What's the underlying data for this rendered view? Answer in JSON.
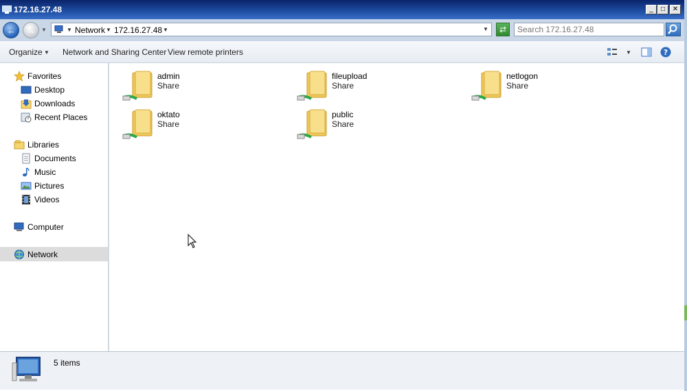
{
  "window": {
    "title": "172.16.27.48",
    "controls": {
      "minimize": "_",
      "maximize": "□",
      "close": "✕"
    }
  },
  "address": {
    "breadcrumbs": [
      "Network",
      "172.16.27.48"
    ],
    "search_placeholder": "Search 172.16.27.48"
  },
  "toolbar": {
    "organize": "Organize",
    "network_sharing": "Network and Sharing Center",
    "view_printers": "View remote printers"
  },
  "navigation": {
    "favorites": {
      "label": "Favorites",
      "items": [
        "Desktop",
        "Downloads",
        "Recent Places"
      ]
    },
    "libraries": {
      "label": "Libraries",
      "items": [
        "Documents",
        "Music",
        "Pictures",
        "Videos"
      ]
    },
    "computer": "Computer",
    "network": "Network",
    "selected": "Network"
  },
  "shares": [
    {
      "name": "admin",
      "type": "Share"
    },
    {
      "name": "fileupload",
      "type": "Share"
    },
    {
      "name": "netlogon",
      "type": "Share"
    },
    {
      "name": "oktato",
      "type": "Share"
    },
    {
      "name": "public",
      "type": "Share"
    }
  ],
  "status": {
    "count_text": "5 items"
  },
  "colors": {
    "titlebar": "#0a246a",
    "selection": "#dcdcdc",
    "folder": "#f5d56e",
    "network_cable": "#2fa84a"
  },
  "icons": [
    "computer-icon",
    "back-arrow-icon",
    "forward-arrow-icon",
    "refresh-icon",
    "search-icon",
    "view-options-icon",
    "preview-pane-icon",
    "help-icon",
    "star-icon",
    "desktop-icon",
    "downloads-icon",
    "recent-places-icon",
    "library-icon",
    "documents-icon",
    "music-icon",
    "pictures-icon",
    "videos-icon",
    "network-icon",
    "share-folder-icon",
    "mouse-cursor-icon"
  ]
}
